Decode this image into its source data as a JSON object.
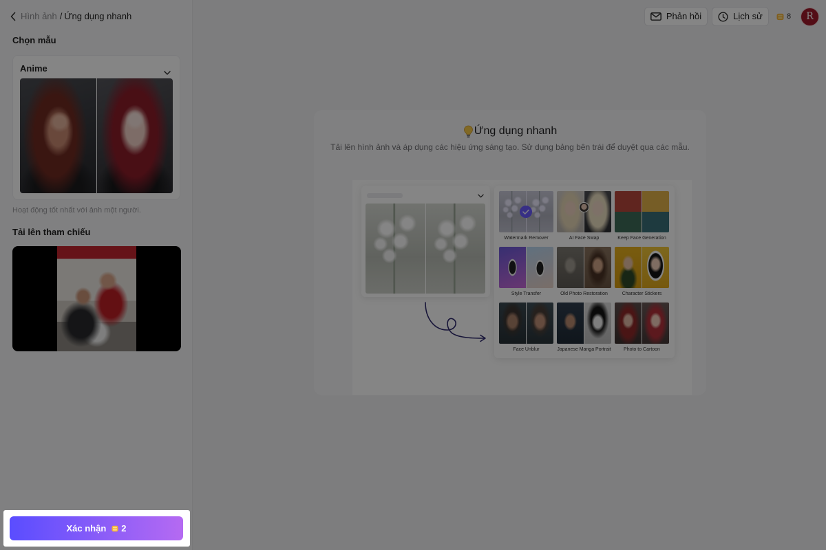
{
  "breadcrumb": {
    "parent": "Hình ảnh",
    "separator": "/",
    "current": "Ứng dụng nhanh"
  },
  "header": {
    "feedback_label": "Phản hồi",
    "history_label": "Lịch sử",
    "credits": "8",
    "avatar_initial": "R"
  },
  "sidebar": {
    "template_section_title": "Chọn mẫu",
    "template_select_value": "Anime",
    "template_hint": "Hoạt động tốt nhất với ảnh một người.",
    "upload_section_title": "Tải lên tham chiếu"
  },
  "confirm": {
    "label": "Xác nhận",
    "cost": "2"
  },
  "main": {
    "title": "Ứng dụng nhanh",
    "subtitle": "Tải lên hình ảnh và áp dụng các hiệu ứng sáng tạo. Sử dụng bảng bên trái để duyệt qua các mẫu.",
    "templates": [
      {
        "label": "Watermark Remover",
        "selected": true
      },
      {
        "label": "AI Face Swap",
        "selected": false
      },
      {
        "label": "Keep Face Generation",
        "selected": false
      },
      {
        "label": "Style Transfer",
        "selected": false
      },
      {
        "label": "Old Photo Restoration",
        "selected": false
      },
      {
        "label": "Character Stickers",
        "selected": false
      },
      {
        "label": "Face Unblur",
        "selected": false
      },
      {
        "label": "Japanese Manga Portrait",
        "selected": false
      },
      {
        "label": "Photo to Cartoon",
        "selected": false
      }
    ]
  },
  "icons": {
    "back": "chevron-left-icon",
    "feedback": "mail-icon",
    "history": "clock-icon",
    "credits": "coin-icon",
    "template_select": "chevron-down-icon",
    "title": "lightbulb-icon",
    "selected_template": "check-icon",
    "illustration_arrow": "curved-arrow-icon"
  },
  "colors": {
    "accent_start": "#5a4dff",
    "accent_end": "#b56af2",
    "avatar": "#a0192b",
    "coin": "#f3b23a",
    "check": "#6a5cff"
  }
}
